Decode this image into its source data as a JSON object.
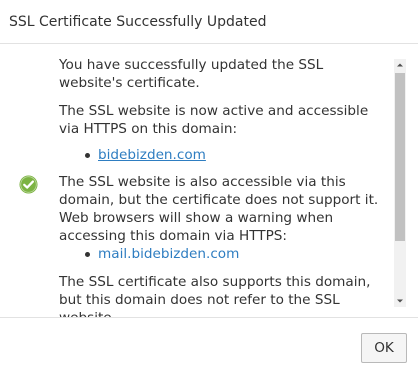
{
  "dialog": {
    "title": "SSL Certificate Successfully Updated",
    "ok_label": "OK"
  },
  "message": {
    "para1": "You have successfully updated the SSL website's certificate.",
    "para2": "The SSL website is now active and accessible via HTTPS on this domain:",
    "active_domains": [
      "bidebizden.com"
    ],
    "para3": "The SSL website is also accessible via this domain, but the certificate does not support it. Web browsers will show a warning when accessing this domain via HTTPS:",
    "unsupported_domains": [
      "mail.bidebizden.com"
    ],
    "para4": "The SSL certificate also supports this domain, but this domain does not refer to the SSL website."
  },
  "colors": {
    "link": "#2e7dc1",
    "success_icon": "#7cb342",
    "text": "#333333"
  },
  "icons": {
    "status": "check-circle-icon"
  }
}
